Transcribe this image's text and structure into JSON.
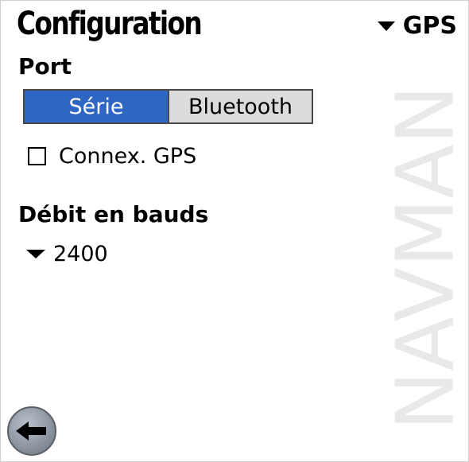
{
  "header": {
    "title": "Configuration",
    "menu_label": "GPS"
  },
  "port": {
    "label": "Port",
    "options": [
      "Série",
      "Bluetooth"
    ],
    "selected": "Série"
  },
  "gps_connection": {
    "label": "Connex. GPS",
    "checked": false
  },
  "baud": {
    "label": "Débit en bauds",
    "value": "2400"
  },
  "watermark": {
    "text": "NAVMAN"
  },
  "icons": {
    "menu": "triangle-down-icon",
    "back": "back-arrow-icon"
  },
  "colors": {
    "selected_segment": "#2f66c3",
    "unselected_segment": "#dcdcdc",
    "watermark": "#e9e9e9"
  }
}
